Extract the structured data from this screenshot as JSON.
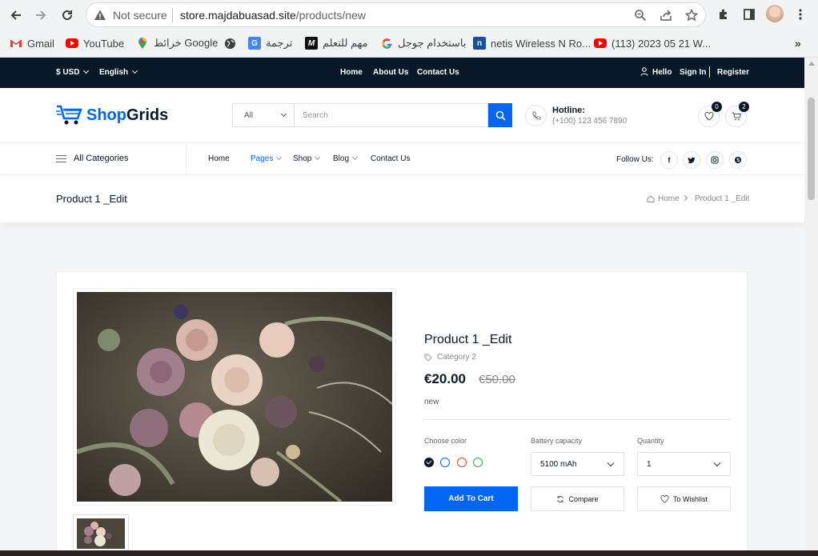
{
  "browser": {
    "not_secure": "Not secure",
    "url_host": "store.majdabuasad.site",
    "url_path": "/products/new"
  },
  "bookmarks": [
    {
      "label": "Gmail",
      "icon": "gmail-icon"
    },
    {
      "label": "YouTube",
      "icon": "youtube-icon"
    },
    {
      "label": "خرائط Google",
      "icon": "maps-icon"
    },
    {
      "label": "",
      "icon": "globe-icon"
    },
    {
      "label": "ترجمة",
      "icon": "translate-icon"
    },
    {
      "label": "مهم للتعلم",
      "icon": "m-icon"
    },
    {
      "label": "باستخدام جوجل",
      "icon": "google-icon"
    },
    {
      "label": "netis Wireless N Ro...",
      "icon": "netis-icon"
    },
    {
      "label": "(113) 2023 05 21 W...",
      "icon": "youtube-icon"
    }
  ],
  "topbar": {
    "currency": "$ USD",
    "language": "English",
    "links": [
      "Home",
      "About Us",
      "Contact Us"
    ],
    "hello": "Hello",
    "sign_in": "Sign In",
    "register": "Register"
  },
  "header": {
    "logo_prefix": "Shop",
    "logo_suffix": "Grids",
    "search_category": "All",
    "search_placeholder": "Search",
    "hotline_label": "Hotline:",
    "hotline_number": "(+100) 123 456 7890",
    "wishlist_count": "0",
    "cart_count": "2"
  },
  "navbar": {
    "all_categories": "All Categories",
    "items": [
      "Home",
      "Pages",
      "Shop",
      "Blog",
      "Contact Us"
    ],
    "follow_us": "Follow Us:"
  },
  "breadcrumb": {
    "title": "Product 1 _Edit",
    "home": "Home",
    "current": "Product 1 _Edit"
  },
  "product": {
    "title": "Product 1 _Edit",
    "category": "Category 2",
    "price": "€20.00",
    "old_price": "€50.00",
    "description": "new",
    "color_label": "Choose color",
    "colors": [
      "#081828",
      "#0167f3",
      "#e03c2a",
      "#2da84a"
    ],
    "battery_label": "Battery capacity",
    "battery_value": "5100 mAh",
    "quantity_label": "Quantity",
    "quantity_value": "1",
    "add_to_cart": "Add To Cart",
    "compare": "Compare",
    "wishlist": "To Wishlist"
  }
}
